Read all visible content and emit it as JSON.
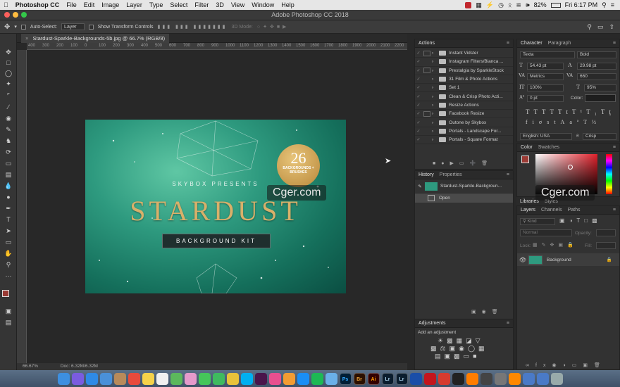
{
  "menubar": {
    "app": "Photoshop CC",
    "items": [
      "File",
      "Edit",
      "Image",
      "Layer",
      "Type",
      "Select",
      "Filter",
      "3D",
      "View",
      "Window",
      "Help"
    ],
    "battery": "82%",
    "clock": "Fri 6:17 PM"
  },
  "window_title": "Adobe Photoshop CC 2018",
  "options": {
    "auto_select_label": "Auto-Select:",
    "auto_select_value": "Layer",
    "show_transform_label": "Show Transform Controls",
    "mode_3d": "3D Mode:"
  },
  "document": {
    "tab_label": "Stardust-Sparkle-Backgrounds-5b.jpg @ 66.7% (RGB/8)",
    "zoom": "66.67%",
    "doc_size": "Doc: 6.32M/6.32M",
    "ruler_ticks": [
      "400",
      "300",
      "200",
      "100",
      "0",
      "100",
      "200",
      "300",
      "400",
      "500",
      "600",
      "700",
      "800",
      "900",
      "1000",
      "1100",
      "1200",
      "1300",
      "1400",
      "1500",
      "1600",
      "1700",
      "1800",
      "1900",
      "2000",
      "2100",
      "2200"
    ]
  },
  "artwork": {
    "badge_number": "26",
    "badge_text": "BACKGROUNDS + BRUSHES",
    "presenter": "SKYBOX PRESENTS",
    "title": "STARDUST",
    "subtitle": "BACKGROUND KIT"
  },
  "actions_panel": {
    "tab": "Actions",
    "items": [
      "Instant Vidster",
      "Instagram Filters/Bianca ...",
      "Prestalgia by SparkleStock",
      "31 Film & Photo Actions",
      "Set 1",
      "Clean & Crisp Photo Acti...",
      "Resize Actions",
      "Facebook Resize",
      "Outone by Skybox",
      "Portals - Landscape For...",
      "Portals - Square Format"
    ]
  },
  "history_panel": {
    "tabs": [
      "History",
      "Properties"
    ],
    "snapshot": "Stardust-Sparkle-Backgroun...",
    "state": "Open"
  },
  "adjustments_panel": {
    "tab": "Adjustments",
    "hint": "Add an adjustment"
  },
  "character_panel": {
    "tabs": [
      "Character",
      "Paragraph"
    ],
    "font_family": "Texta",
    "font_style": "Bold",
    "size": "54.43 pt",
    "leading": "29.98 pt",
    "kerning": "Metrics",
    "tracking": "660",
    "vscale": "100%",
    "hscale": "95%",
    "baseline": "0 pt",
    "color_label": "Color:",
    "language": "English: USA",
    "aa": "Crisp"
  },
  "color_panel": {
    "tabs": [
      "Color",
      "Swatches"
    ],
    "fg": "#9b3a34"
  },
  "libraries_tabs": [
    "Libraries",
    "Styles"
  ],
  "layers_panel": {
    "tabs": [
      "Layers",
      "Channels",
      "Paths"
    ],
    "kind": "Kind",
    "blend": "Normal",
    "opacity_label": "Opacity:",
    "lock_label": "Lock:",
    "fill_label": "Fill:",
    "layer_name": "Background"
  },
  "watermarks": [
    "Cger.com",
    "Cger.com"
  ],
  "dock_apps": [
    "Finder",
    "Siri",
    "Safari",
    "Mail",
    "Contacts",
    "Calendar",
    "Notes",
    "Reminders",
    "Maps",
    "Photos",
    "Messages",
    "FaceTime",
    "Chrome",
    "Skype",
    "Slack",
    "iTunes",
    "iBooks",
    "App Store",
    "Spotify",
    "Preview",
    "Ps",
    "Br",
    "Ai",
    "Lr",
    "Lr",
    "Xcode",
    "Acrobat",
    "PDF",
    "Terminal",
    "Media",
    "Console",
    "Utility",
    "VLC",
    "Folder",
    "Downloads",
    "Trash"
  ]
}
